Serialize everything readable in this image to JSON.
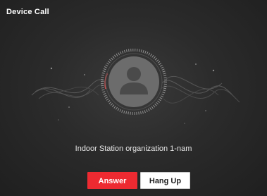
{
  "dialog": {
    "title": "Device Call",
    "caller_name": "Indoor Station organization 1-nam",
    "answer_label": "Answer",
    "hangup_label": "Hang Up"
  },
  "icons": {
    "avatar": "user-avatar-icon"
  },
  "colors": {
    "answer_button": "#ed2a31",
    "background": "#2b2b2b"
  }
}
